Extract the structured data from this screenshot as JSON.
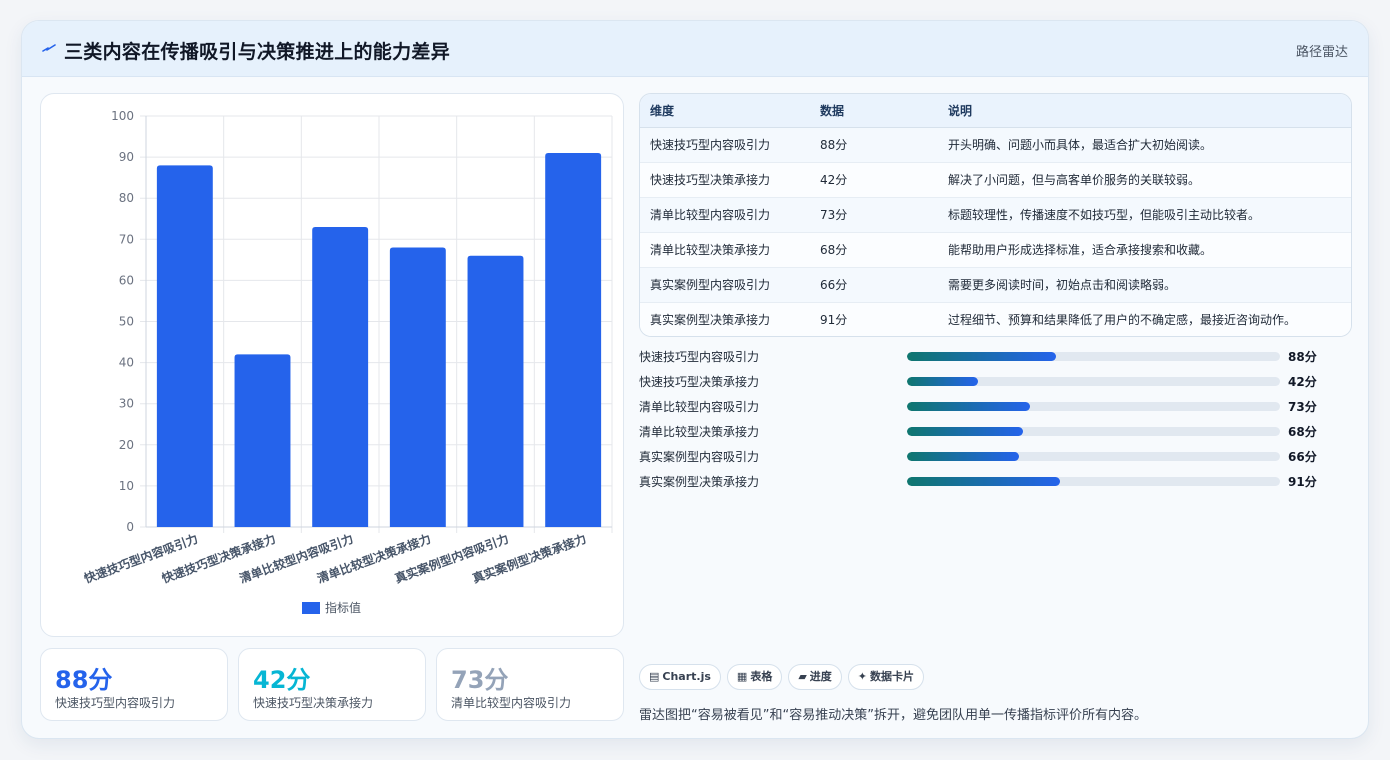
{
  "header": {
    "title": "三类内容在传播吸引与决策推进上的能力差异",
    "tag": "路径雷达"
  },
  "colors": {
    "bar": "#2563eb",
    "kpi": [
      "#2563eb",
      "#06b6d4",
      "#94a3b8"
    ]
  },
  "chart_data": {
    "type": "bar",
    "categories": [
      "快速技巧型内容吸引力",
      "快速技巧型决策承接力",
      "清单比较型内容吸引力",
      "清单比较型决策承接力",
      "真实案例型内容吸引力",
      "真实案例型决策承接力"
    ],
    "series": [
      {
        "name": "指标值",
        "values": [
          88,
          42,
          73,
          68,
          66,
          91
        ]
      }
    ],
    "ylim": [
      0,
      100
    ],
    "yticks": [
      "0",
      "10",
      "20",
      "30",
      "40",
      "50",
      "60",
      "70",
      "80",
      "90",
      "100"
    ],
    "grid": true,
    "legend": "bottom"
  },
  "kpis": [
    {
      "value": "88分",
      "label": "快速技巧型内容吸引力"
    },
    {
      "value": "42分",
      "label": "快速技巧型决策承接力"
    },
    {
      "value": "73分",
      "label": "清单比较型内容吸引力"
    }
  ],
  "table": {
    "headers": [
      "维度",
      "数据",
      "说明"
    ],
    "rows": [
      [
        "快速技巧型内容吸引力",
        "88分",
        "开头明确、问题小而具体，最适合扩大初始阅读。"
      ],
      [
        "快速技巧型决策承接力",
        "42分",
        "解决了小问题，但与高客单价服务的关联较弱。"
      ],
      [
        "清单比较型内容吸引力",
        "73分",
        "标题较理性，传播速度不如技巧型，但能吸引主动比较者。"
      ],
      [
        "清单比较型决策承接力",
        "68分",
        "能帮助用户形成选择标准，适合承接搜索和收藏。"
      ],
      [
        "真实案例型内容吸引力",
        "66分",
        "需要更多阅读时间，初始点击和阅读略弱。"
      ],
      [
        "真实案例型决策承接力",
        "91分",
        "过程细节、预算和结果降低了用户的不确定感，最接近咨询动作。"
      ]
    ]
  },
  "progress": [
    {
      "label": "快速技巧型内容吸引力",
      "value": "88分",
      "fraction": 0.4
    },
    {
      "label": "快速技巧型决策承接力",
      "value": "42分",
      "fraction": 0.19
    },
    {
      "label": "清单比较型内容吸引力",
      "value": "73分",
      "fraction": 0.33
    },
    {
      "label": "清单比较型决策承接力",
      "value": "68分",
      "fraction": 0.31
    },
    {
      "label": "真实案例型内容吸引力",
      "value": "66分",
      "fraction": 0.3
    },
    {
      "label": "真实案例型决策承接力",
      "value": "91分",
      "fraction": 0.41
    }
  ],
  "chips": [
    {
      "icon": "▤",
      "label": "Chart.js"
    },
    {
      "icon": "▦",
      "label": "表格"
    },
    {
      "icon": "▰",
      "label": "进度"
    },
    {
      "icon": "✦",
      "label": "数据卡片"
    }
  ],
  "footer": "雷达图把“容易被看见”和“容易推动决策”拆开，避免团队用单一传播指标评价所有内容。"
}
